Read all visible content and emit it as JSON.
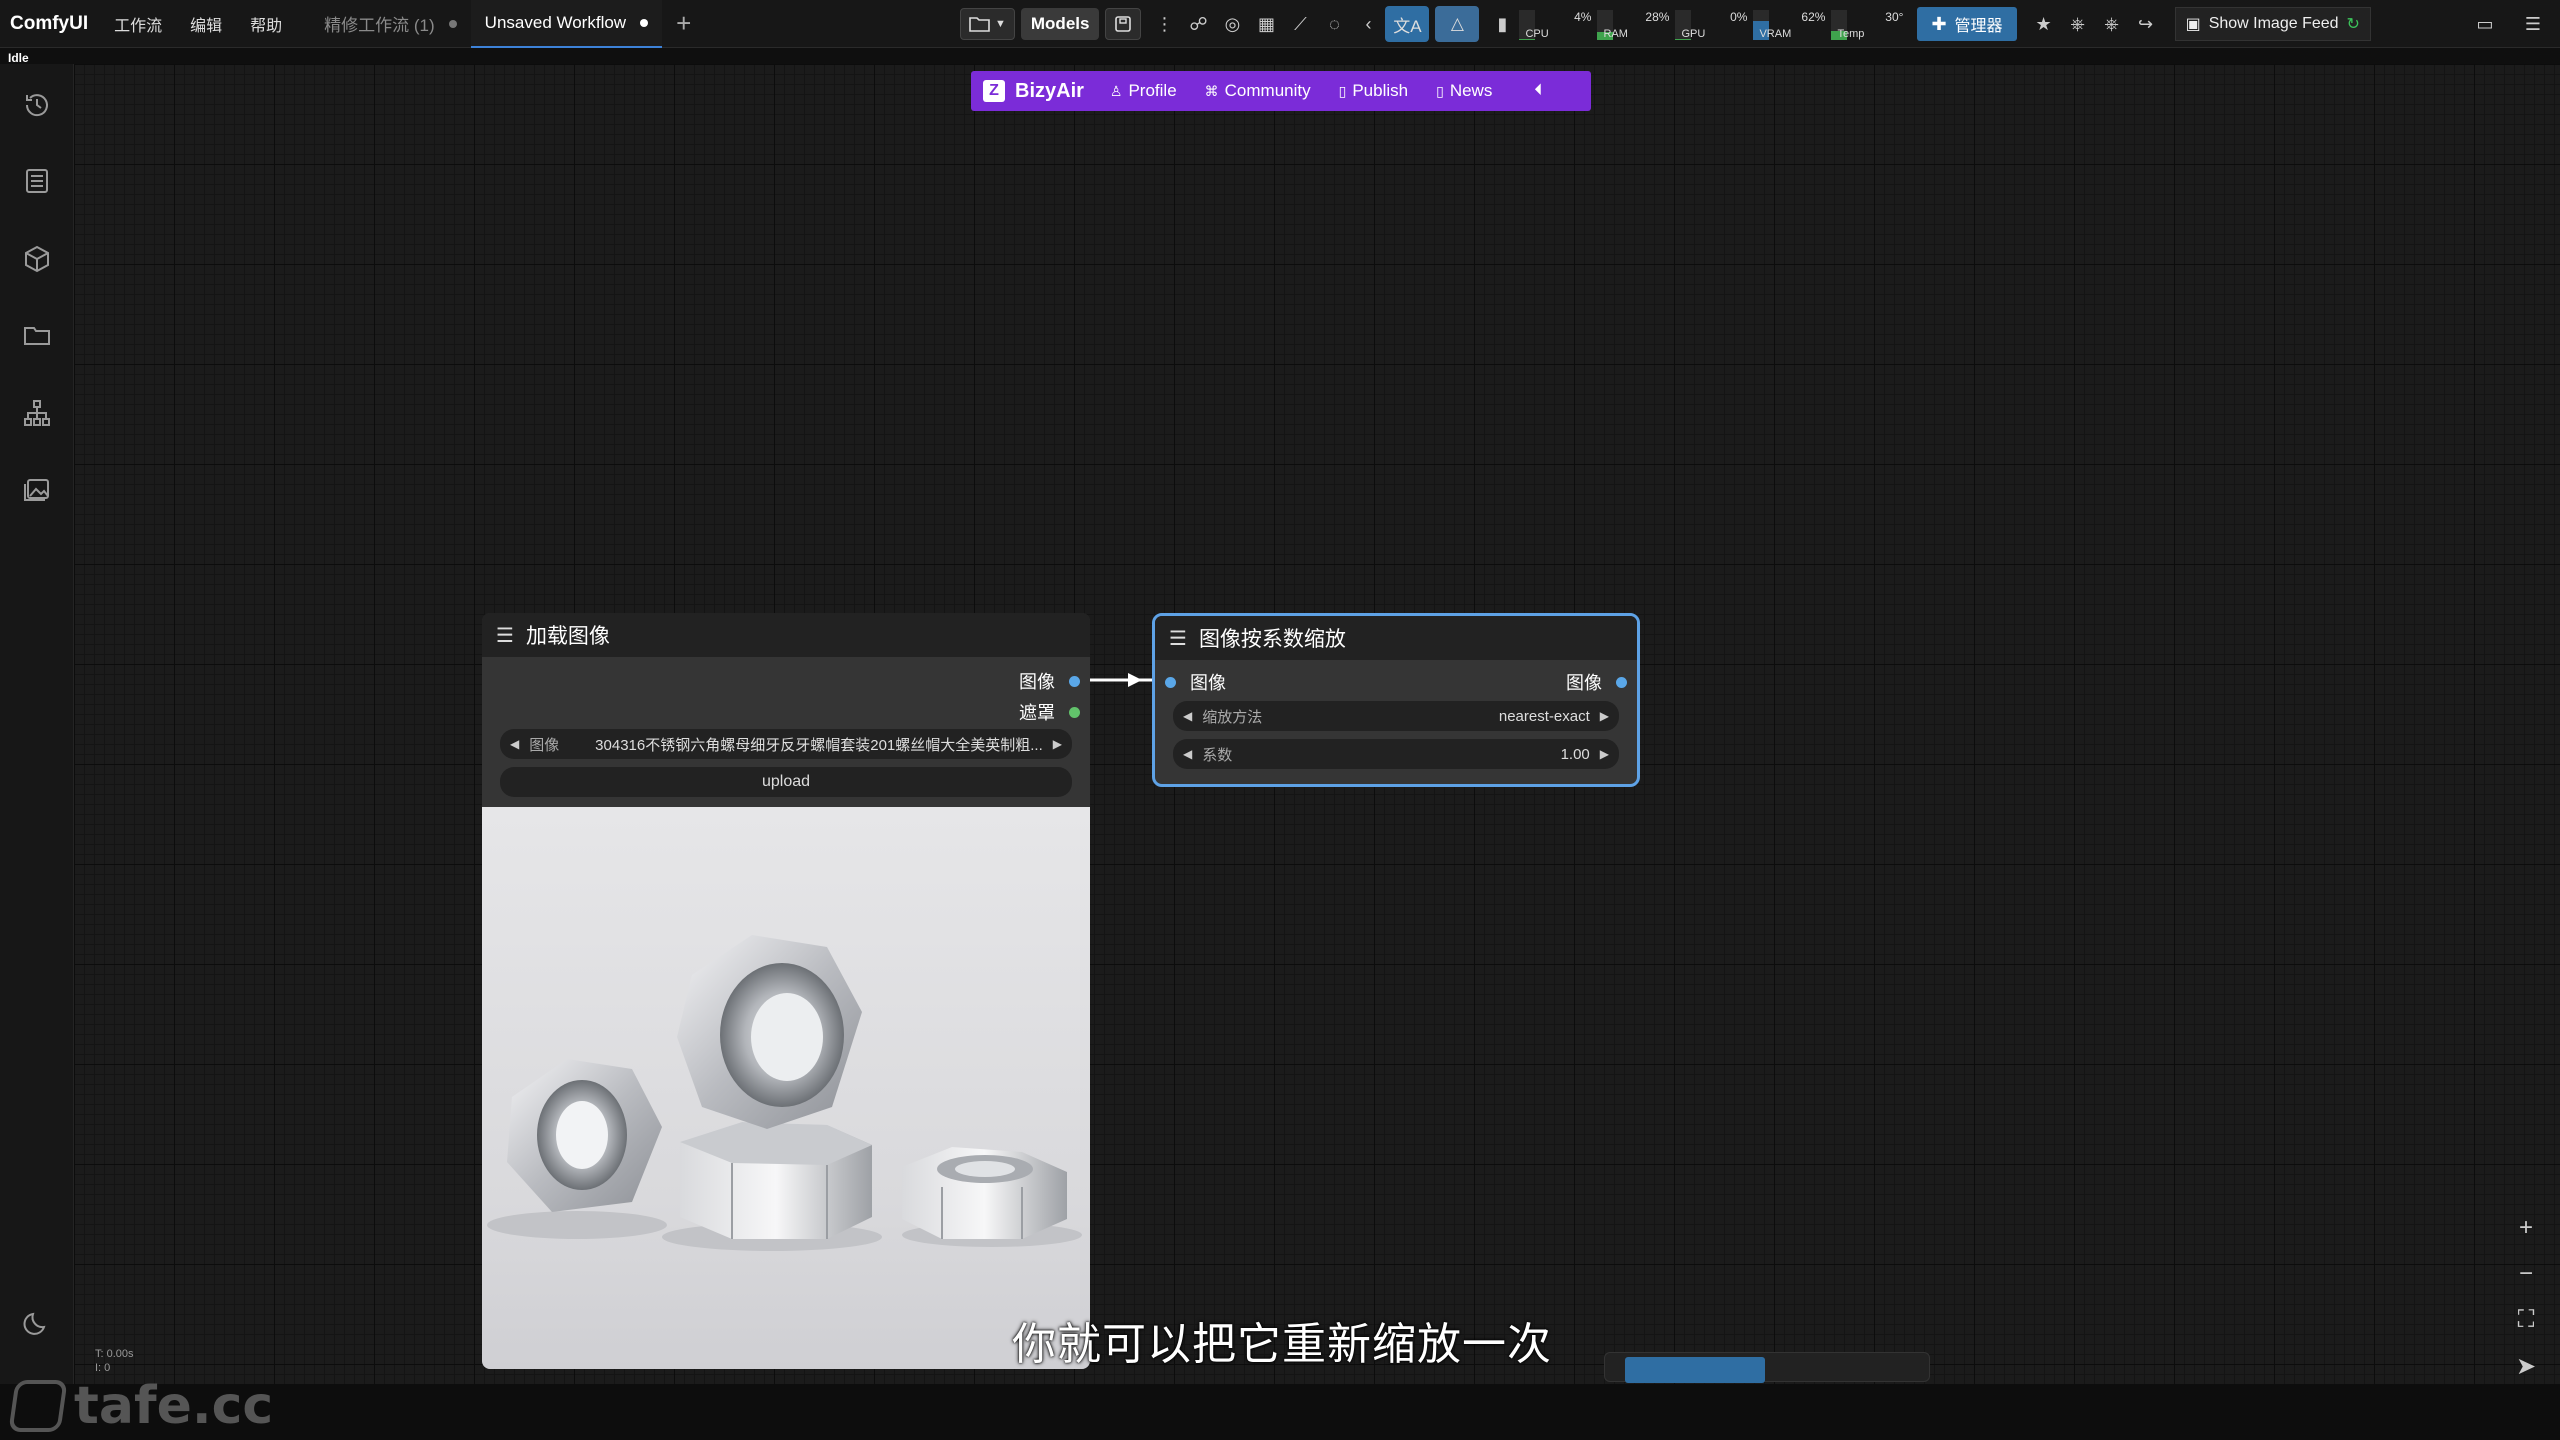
{
  "app": {
    "brand": "ComfyUI",
    "menu": [
      "工作流",
      "编辑",
      "帮助"
    ],
    "status": "Idle"
  },
  "tabs": [
    {
      "label": "精修工作流 (1)",
      "active": false
    },
    {
      "label": "Unsaved Workflow",
      "active": true
    }
  ],
  "toolbar": {
    "models_label": "Models",
    "manager_label": "管理器",
    "image_feed_label": "Show Image Feed",
    "meters": [
      {
        "label": "CPU",
        "value": "4%",
        "fill": 0.04,
        "color": "#3fa34d"
      },
      {
        "label": "RAM",
        "value": "28%",
        "fill": 0.28,
        "color": "#3fa34d"
      },
      {
        "label": "GPU",
        "value": "0%",
        "fill": 0.0,
        "color": "#3fa34d"
      },
      {
        "label": "VRAM",
        "value": "62%",
        "fill": 0.62,
        "color": "#2f6ea3"
      },
      {
        "label": "Temp",
        "value": "30°",
        "fill": 0.3,
        "color": "#3fa34d"
      }
    ]
  },
  "sidebar": {
    "items": [
      "history-icon",
      "queue-icon",
      "model-library-icon",
      "workflows-icon",
      "node-library-icon",
      "image-gallery-icon",
      "theme-toggle-icon"
    ]
  },
  "bizyair": {
    "brand": "BizyAir",
    "nav": [
      "Profile",
      "Community",
      "Publish",
      "News"
    ]
  },
  "nodes": {
    "load_image": {
      "title": "加载图像",
      "outputs": [
        "图像",
        "遮罩"
      ],
      "widget_label": "图像",
      "widget_value": "304316不锈钢六角螺母细牙反牙螺帽套装201螺丝帽大全美英制粗...",
      "upload_label": "upload"
    },
    "scale_by": {
      "title": "图像按系数缩放",
      "input": "图像",
      "output": "图像",
      "widgets": [
        {
          "label": "缩放方法",
          "value": "nearest-exact"
        },
        {
          "label": "系数",
          "value": "1.00"
        }
      ]
    }
  },
  "subtitle": "你就可以把它重新缩放一次",
  "stats": {
    "time": "T: 0.00s",
    "line2": "I: 0"
  },
  "watermark": "tafe.cc",
  "colors": {
    "accent": "#7b2cd8",
    "selection": "#5ea2e6",
    "slot_image": "#5aa7e8",
    "slot_mask": "#62c36b"
  }
}
